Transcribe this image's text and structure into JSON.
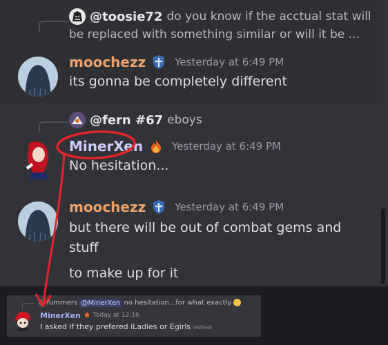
{
  "messages": [
    {
      "reply": {
        "username": "@toosie72",
        "text_line1": "do you know if the acctual stat will",
        "text_line2": "be replaced with something similar or will it be ..."
      },
      "username": "moochezz",
      "username_color": "#f0a26b",
      "badge_icon": "shield-icon",
      "timestamp": "Yesterday at 6:49 PM",
      "lines": [
        "its gonna be completely different"
      ]
    },
    {
      "reply": {
        "username": "@fern #67",
        "text_line1": "eboys"
      },
      "username": "MinerXen",
      "username_color": "#c9cdfb",
      "badge_icon": "fire-icon",
      "timestamp": "Yesterday at 6:49 PM",
      "lines": [
        "No hesitation..."
      ]
    },
    {
      "username": "moochezz",
      "username_color": "#f0a26b",
      "badge_icon": "shield-icon",
      "timestamp": "Yesterday at 6:49 PM",
      "lines": [
        "but there will be out of combat gems and",
        "stuff",
        "to make up for it"
      ]
    }
  ],
  "inset": {
    "reply_username": "@Yummers",
    "reply_mention": "@MinerXen",
    "reply_text": "no hesitation...for what exactly",
    "reply_emoji_icon": "confused-face-icon",
    "username": "MinerXen",
    "badge_icon": "fire-icon",
    "timestamp": "Today at 12:16",
    "text": "I asked if they prefered iLadies or Egirls",
    "edited_label": "(edited)"
  },
  "annotation_color": "#e5252a"
}
